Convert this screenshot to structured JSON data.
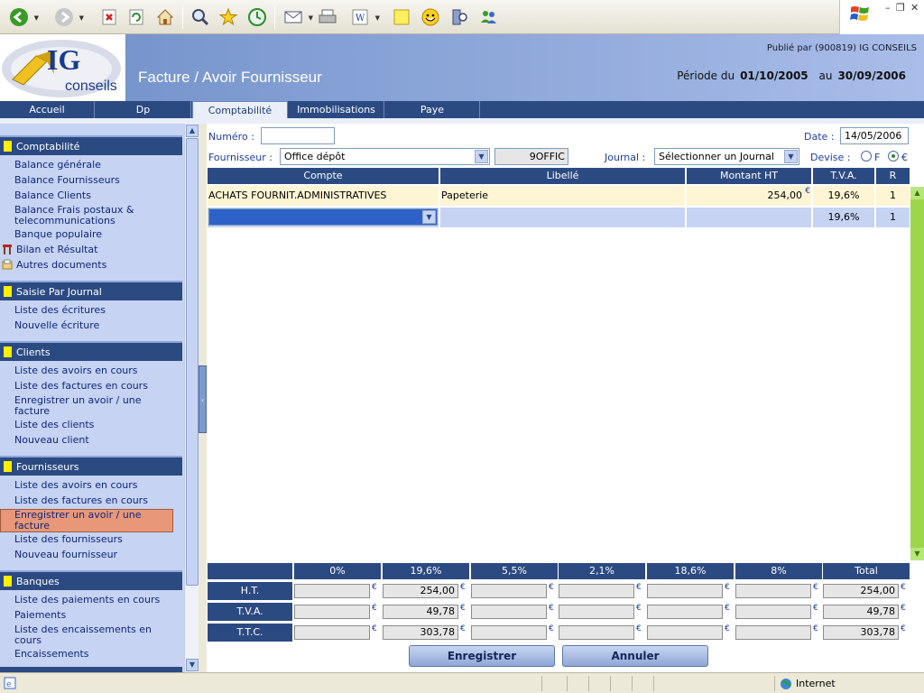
{
  "browser": {
    "toolbar_icons": [
      "back-icon",
      "forward-icon",
      "stop-icon",
      "refresh-icon",
      "home-icon",
      "search-icon",
      "favorites-icon",
      "history-icon",
      "mail-icon",
      "print-icon",
      "edit-word-icon",
      "note-icon",
      "messenger-smiley-icon",
      "research-icon",
      "messenger-people-icon"
    ]
  },
  "header": {
    "logo_text": "IG",
    "logo_sub": "conseils",
    "title": "Facture / Avoir Fournisseur",
    "published_by": "Publié par (900819) IG CONSEILS",
    "period_label": "Période du",
    "period_from": "01/10/2005",
    "period_to_label": "au",
    "period_to": "30/09/2006"
  },
  "nav": {
    "tabs": [
      "Accueil",
      "Dp",
      "Comptabilité",
      "Immobilisations",
      "Paye"
    ],
    "active": "Comptabilité"
  },
  "sidebar": {
    "comptabilite": {
      "title": "Comptabilité",
      "items": [
        "Balance générale",
        "Balance Fournisseurs",
        "Balance Clients",
        "Balance Frais postaux & telecommunications",
        "Banque populaire",
        "Bilan et Résultat",
        "Autres documents"
      ]
    },
    "saisie": {
      "title": "Saisie Par Journal",
      "items": [
        "Liste des écritures",
        "Nouvelle écriture"
      ]
    },
    "clients": {
      "title": "Clients",
      "items": [
        "Liste des avoirs en cours",
        "Liste des factures en cours",
        "Enregistrer un avoir / une facture",
        "Liste des clients",
        "Nouveau client"
      ]
    },
    "fournisseurs": {
      "title": "Fournisseurs",
      "items": [
        "Liste des avoirs en cours",
        "Liste des factures en cours",
        "Enregistrer un avoir / une facture",
        "Liste des fournisseurs",
        "Nouveau fournisseur"
      ]
    },
    "banques": {
      "title": "Banques",
      "items": [
        "Liste des paiements en cours",
        "Paiements",
        "Liste des encaissements en cours",
        "Encaissements"
      ]
    }
  },
  "form": {
    "numero_label": "Numéro :",
    "numero_value": "",
    "date_label": "Date :",
    "date_value": "14/05/2006",
    "fournisseur_label": "Fournisseur :",
    "fournisseur_value": "Office dépôt",
    "fournisseur_code": "9OFFIC",
    "journal_label": "Journal :",
    "journal_value": "Sélectionner un Journal",
    "devise_label": "Devise :",
    "devise_f": "F",
    "devise_e": "€"
  },
  "lines": {
    "headers": [
      "Compte",
      "Libellé",
      "Montant HT",
      "T.V.A.",
      "R"
    ],
    "rows": [
      {
        "compte": "ACHATS FOURNIT.ADMINISTRATIVES",
        "libelle": "Papeterie",
        "montant": "254,00",
        "tva": "19,6%",
        "r": "1"
      },
      {
        "compte": "",
        "libelle": "",
        "montant": "",
        "tva": "19,6%",
        "r": "1"
      }
    ],
    "currency": "€"
  },
  "summary": {
    "headers": [
      "0%",
      "19,6%",
      "5,5%",
      "2,1%",
      "18,6%",
      "8%",
      "Total"
    ],
    "rows": [
      {
        "label": "H.T.",
        "values": [
          "",
          "254,00",
          "",
          "",
          "",
          "",
          "254,00"
        ]
      },
      {
        "label": "T.V.A.",
        "values": [
          "",
          "49,78",
          "",
          "",
          "",
          "",
          "49,78"
        ]
      },
      {
        "label": "T.T.C.",
        "values": [
          "",
          "303,78",
          "",
          "",
          "",
          "",
          "303,78"
        ]
      }
    ],
    "currency": "€"
  },
  "actions": {
    "save": "Enregistrer",
    "cancel": "Annuler"
  },
  "status": {
    "zone": "Internet"
  },
  "colors": {
    "nav_bg": "#2c4a82",
    "sidebar_bg": "#c6d3f3",
    "row_highlight": "#fdf5d3",
    "active_item": "#e89878"
  }
}
